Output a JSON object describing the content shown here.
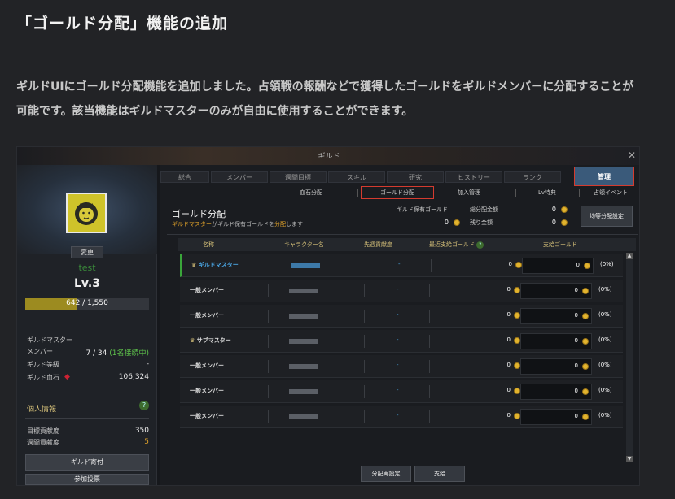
{
  "article": {
    "title": "「ゴールド分配」機能の追加",
    "body": "ギルドUIにゴールド分配機能を追加しました。占領戦の報酬などで獲得したゴールドをギルドメンバーに分配することが可能です。該当機能はギルドマスターのみが自由に使用することができます。"
  },
  "window": {
    "title": "ギルド",
    "close": "✕"
  },
  "guild": {
    "change_button": "変更",
    "name": "test",
    "level": "Lv.3",
    "xp_text": "642 / 1,550",
    "xp_fraction": 0.414,
    "info": [
      {
        "label": "ギルドマスター",
        "value": ""
      },
      {
        "label": "メンバー",
        "value": "7 / 34",
        "extra": "(1名接続中)"
      },
      {
        "label": "ギルド等級",
        "value": "-"
      },
      {
        "label": "ギルド血石",
        "value": "106,324"
      }
    ],
    "personal_title": "個人情報",
    "help_mark": "?",
    "stats": [
      {
        "label": "目標貢献度",
        "value": "350"
      },
      {
        "label": "週間貢献度",
        "value": "5"
      }
    ],
    "buttons": [
      "ギルド寄付",
      "参加投票"
    ]
  },
  "tabs": [
    "総合",
    "メンバー",
    "週間目標",
    "スキル",
    "研究",
    "ヒストリー",
    "ランク",
    "管理"
  ],
  "active_tab": "管理",
  "subtabs": [
    "血石分配",
    "ゴールド分配",
    "加入管理",
    "Lv特典",
    "占領イベント"
  ],
  "active_subtab": "ゴールド分配",
  "gold": {
    "title": "ゴールド分配",
    "subtitle_master": "ギルドマスター",
    "subtitle_mid": "がギルド保有ゴールドを",
    "subtitle_dist": "分配",
    "subtitle_end": "します",
    "held_label": "ギルド保有ゴールド",
    "held_value": "0",
    "total_label": "総分配金額",
    "total_value": "0",
    "remain_label": "残り金額",
    "remain_value": "0",
    "even_button": "均等分配設定"
  },
  "table": {
    "headers": [
      "名称",
      "キャラクター名",
      "先週貢献度",
      "最近支給ゴールド",
      "支給ゴールド"
    ],
    "help_mark": "?",
    "rows": [
      {
        "role": "ギルドマスター",
        "crown": "♛",
        "contrib": "-",
        "recent": "0",
        "pay": "0",
        "pct": "(0%)",
        "master": true
      },
      {
        "role": "一般メンバー",
        "crown": "",
        "contrib": "-",
        "recent": "0",
        "pay": "0",
        "pct": "(0%)",
        "master": false
      },
      {
        "role": "一般メンバー",
        "crown": "",
        "contrib": "-",
        "recent": "0",
        "pay": "0",
        "pct": "(0%)",
        "master": false
      },
      {
        "role": "サブマスター",
        "crown": "♛",
        "contrib": "-",
        "recent": "0",
        "pay": "0",
        "pct": "(0%)",
        "master": false
      },
      {
        "role": "一般メンバー",
        "crown": "",
        "contrib": "-",
        "recent": "0",
        "pay": "0",
        "pct": "(0%)",
        "master": false
      },
      {
        "role": "一般メンバー",
        "crown": "",
        "contrib": "-",
        "recent": "0",
        "pay": "0",
        "pct": "(0%)",
        "master": false
      },
      {
        "role": "一般メンバー",
        "crown": "",
        "contrib": "-",
        "recent": "0",
        "pay": "0",
        "pct": "(0%)",
        "master": false
      }
    ]
  },
  "footer_buttons": [
    "分配再設定",
    "支給"
  ],
  "colors": {
    "accent_red": "#d43b2f",
    "gold": "#e1b32e",
    "level_bar": "#9c8b20"
  }
}
